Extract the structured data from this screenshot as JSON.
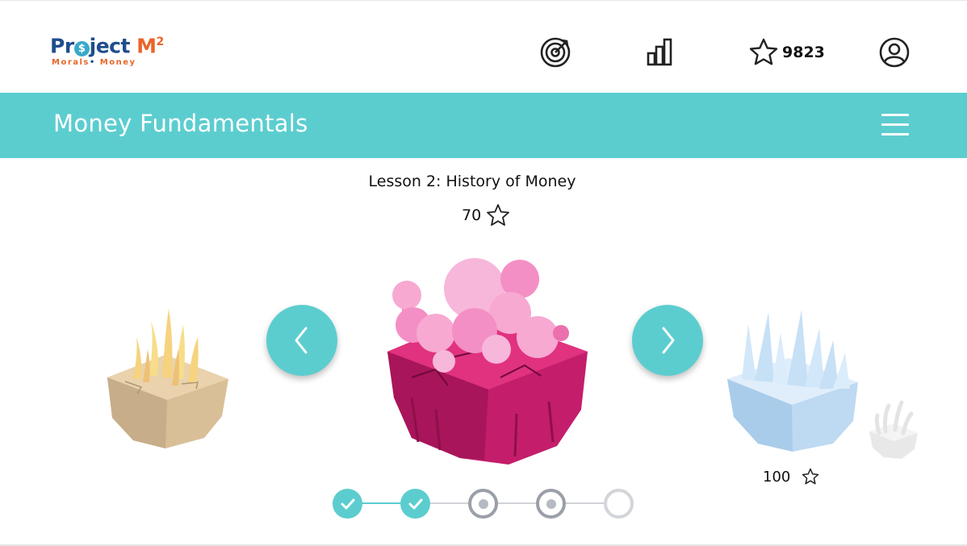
{
  "header": {
    "logo": {
      "name": "Project M",
      "superscript": "2",
      "tagline_part1": "Morals",
      "tagline_part2": "Money"
    },
    "icons": [
      "goals-target-icon",
      "leaderboard-chart-icon",
      "star-icon",
      "profile-user-icon"
    ],
    "star_total": "9823"
  },
  "banner": {
    "title": "Money Fundamentals",
    "menu_icon": "hamburger-menu-icon"
  },
  "lesson": {
    "title": "Lesson 2: History of Money",
    "stars": "70"
  },
  "carousel": {
    "prev_icon": "chevron-left-icon",
    "next_icon": "chevron-right-icon",
    "islands": [
      {
        "theme": "fire-desert",
        "position": "previous"
      },
      {
        "theme": "pink-crystal",
        "position": "current"
      },
      {
        "theme": "ice",
        "position": "next",
        "stars": "100"
      },
      {
        "theme": "snow-coral",
        "position": "upcoming"
      }
    ]
  },
  "progress": {
    "steps": [
      {
        "state": "completed"
      },
      {
        "state": "completed"
      },
      {
        "state": "in-progress"
      },
      {
        "state": "in-progress"
      },
      {
        "state": "locked"
      }
    ]
  },
  "colors": {
    "accent": "#5ccdcf",
    "brand_blue": "#1f4e8c",
    "brand_orange": "#e8662a"
  }
}
